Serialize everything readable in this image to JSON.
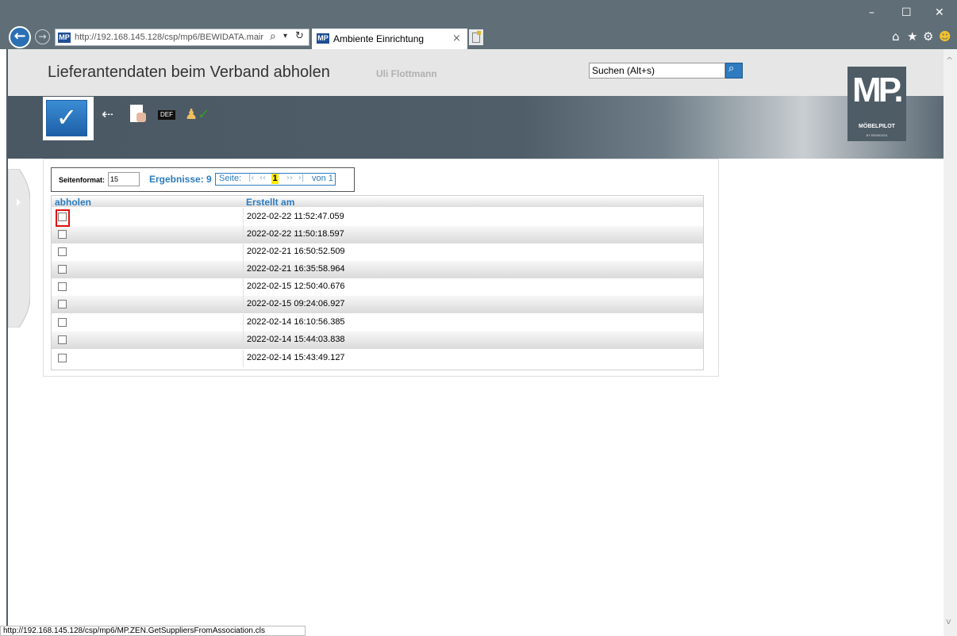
{
  "browser": {
    "address_url": "http://192.168.145.128/csp/mp6/BEWIDATA.mair",
    "favicon_label": "MP",
    "tab_title": "Ambiente Einrichtung",
    "status_url": "http://192.168.145.128/csp/mp6/MP.ZEN.GetSuppliersFromAssociation.cls"
  },
  "header": {
    "title": "Lieferantendaten beim Verband abholen",
    "user": "Uli Flottmann",
    "search_placeholder": "Suchen (Alt+s)"
  },
  "logo": {
    "mark": "MP.",
    "name": "MÖBELPILOT",
    "sub": "BY BEWIDATA"
  },
  "toolbar": {
    "save_symbol": "✓",
    "def_label": "DEF"
  },
  "pager": {
    "page_size_label": "Seitenformat:",
    "page_size_value": "15",
    "results_label": "Ergebnisse: 9",
    "page_label": "Seite:",
    "current_page": "1",
    "total_label": "von 1"
  },
  "table": {
    "columns": [
      "abholen",
      "Erstellt am"
    ],
    "rows": [
      {
        "checked": false,
        "created": "2022-02-22 11:52:47.059"
      },
      {
        "checked": false,
        "created": "2022-02-22 11:50:18.597"
      },
      {
        "checked": false,
        "created": "2022-02-21 16:50:52.509"
      },
      {
        "checked": false,
        "created": "2022-02-21 16:35:58.964"
      },
      {
        "checked": false,
        "created": "2022-02-15 12:50:40.676"
      },
      {
        "checked": false,
        "created": "2022-02-15 09:24:06.927"
      },
      {
        "checked": false,
        "created": "2022-02-14 16:10:56.385"
      },
      {
        "checked": false,
        "created": "2022-02-14 15:44:03.838"
      },
      {
        "checked": false,
        "created": "2022-02-14 15:43:49.127"
      }
    ]
  },
  "colors": {
    "accent": "#2c7cc0",
    "highlight": "#e01010",
    "page_marker": "#ffea00"
  }
}
